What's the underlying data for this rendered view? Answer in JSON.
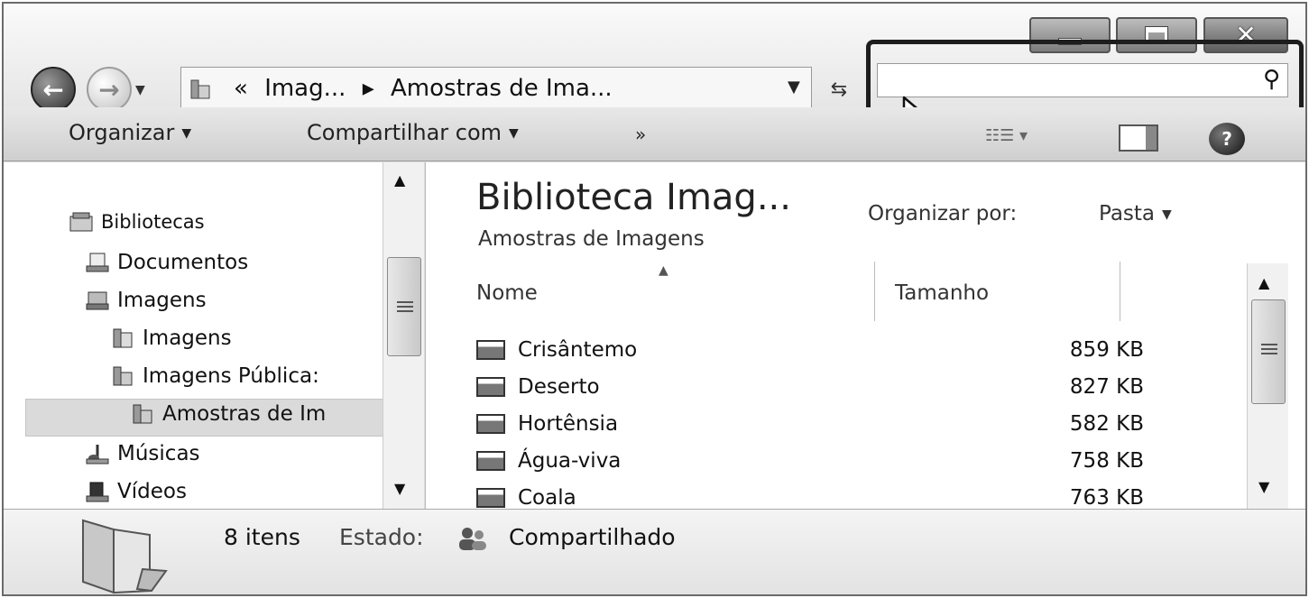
{
  "window": {
    "controls": {
      "minimize": "minimize-icon",
      "maximize": "maximize-icon",
      "close": "close-icon"
    }
  },
  "navigation": {
    "breadcrumb": [
      "«",
      "Imag...",
      "▸",
      "Amostras de Ima..."
    ]
  },
  "search": {
    "placeholder": "",
    "icon": "search-icon"
  },
  "toolbar": {
    "organize": "Organizar",
    "share": "Compartilhar com",
    "more": "»"
  },
  "sidebar": {
    "items": [
      {
        "label": "Bibliotecas",
        "icon": "library-icon"
      },
      {
        "label": "Documentos",
        "icon": "documents-icon"
      },
      {
        "label": "Imagens",
        "icon": "pictures-icon"
      },
      {
        "label": "Imagens",
        "icon": "pictures-folder-icon"
      },
      {
        "label": "Imagens Pública:",
        "icon": "folder-icon"
      },
      {
        "label": "Amostras de Im",
        "icon": "folder-icon",
        "selected": true
      },
      {
        "label": "Músicas",
        "icon": "music-icon"
      },
      {
        "label": "Vídeos",
        "icon": "videos-icon"
      }
    ]
  },
  "library": {
    "title": "Biblioteca Imag...",
    "subtitle": "Amostras de Imagens",
    "arrange_label": "Organizar por:",
    "arrange_value": "Pasta"
  },
  "columns": {
    "name": "Nome",
    "size": "Tamanho"
  },
  "files": [
    {
      "name": "Crisântemo",
      "size": "859 KB"
    },
    {
      "name": "Deserto",
      "size": "827 KB"
    },
    {
      "name": "Hortênsia",
      "size": "582 KB"
    },
    {
      "name": "Água-viva",
      "size": "758 KB"
    },
    {
      "name": "Coala",
      "size": "763 KB"
    }
  ],
  "details": {
    "count": "8 itens",
    "state_label": "Estado:",
    "state_value": "Compartilhado"
  },
  "colors": {
    "highlight": "#1d1d1d",
    "selection": "#dadada"
  }
}
